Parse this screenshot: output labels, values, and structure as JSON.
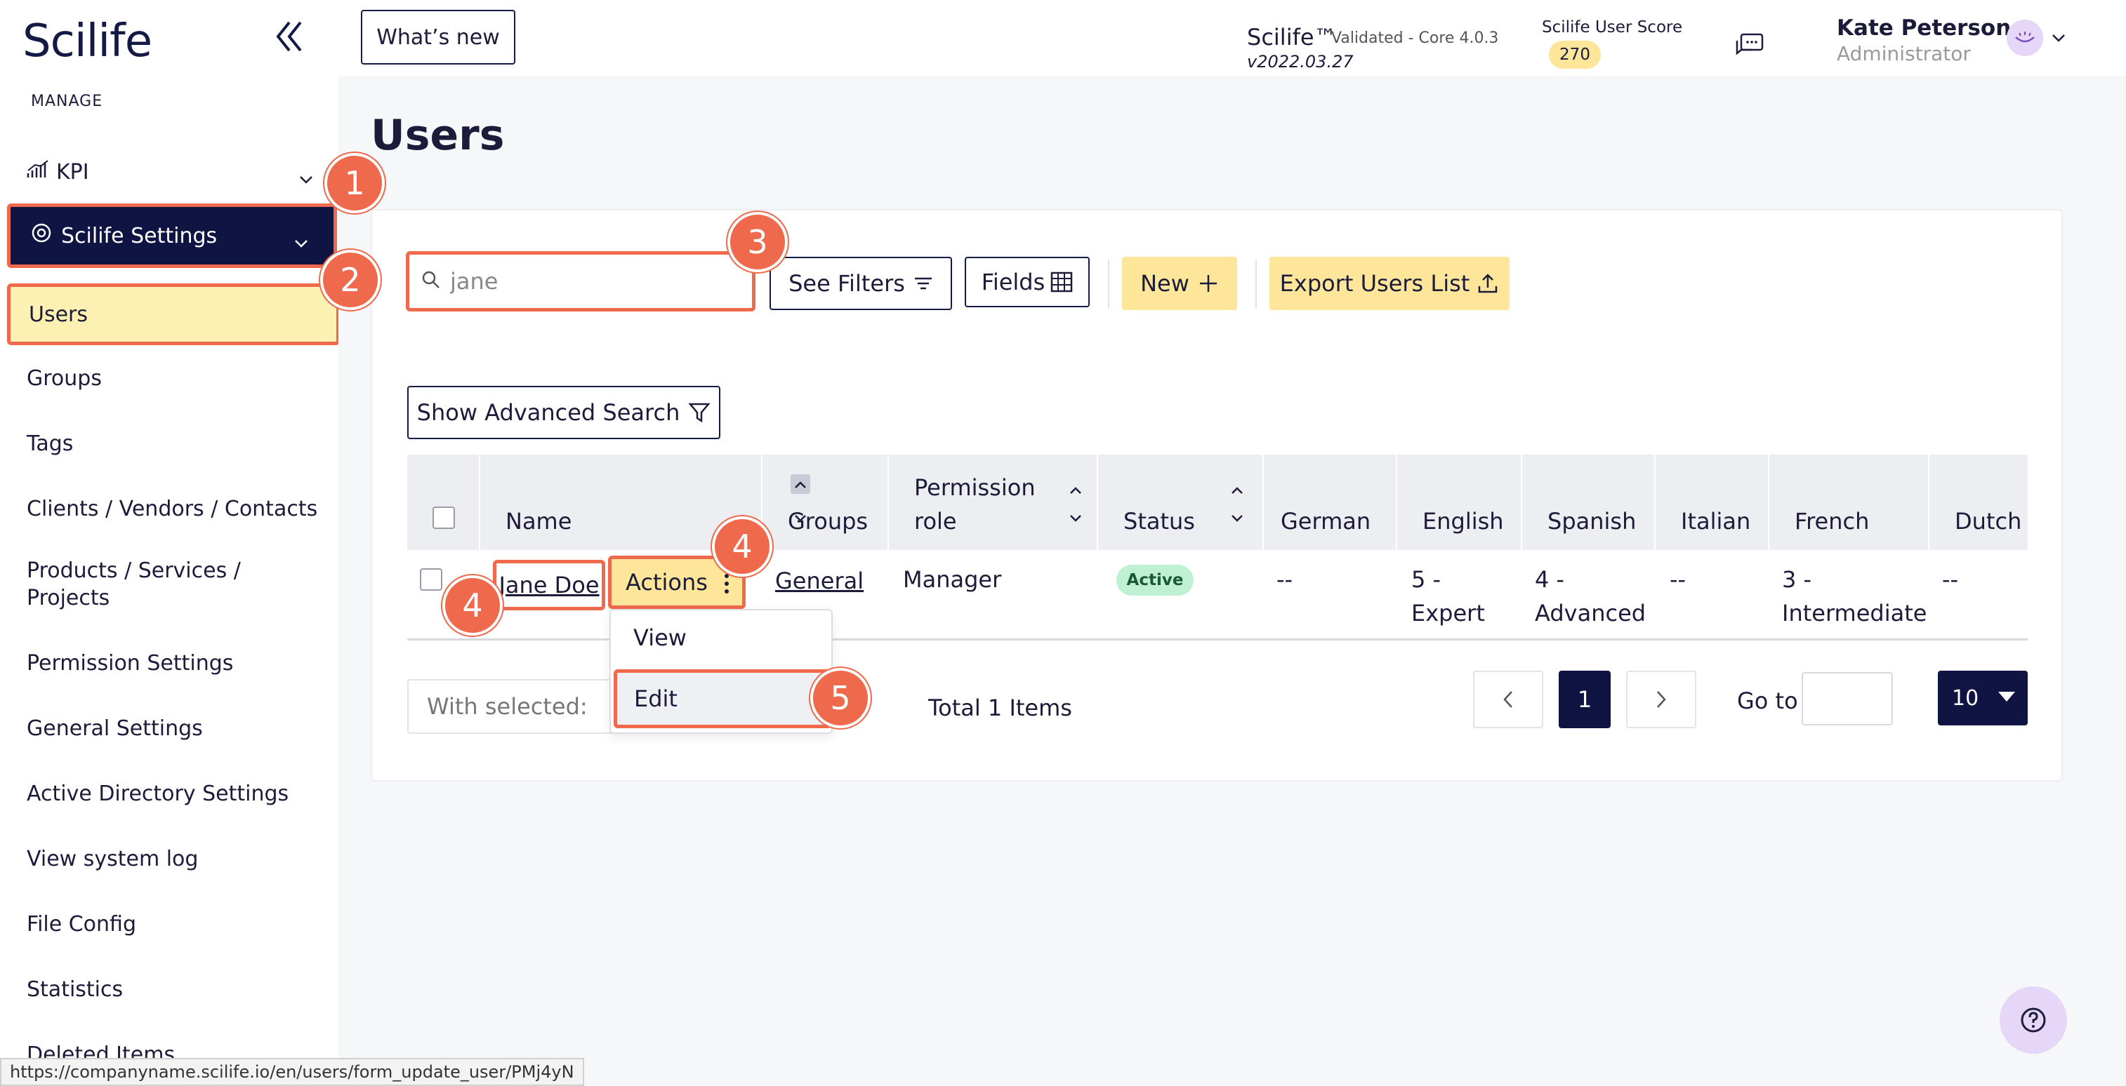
{
  "app": {
    "logo": "Scilife",
    "whats_new": "What’s new",
    "product_name": "Scilife™",
    "product_version": "Validated - Core 4.0.3",
    "build": "v2022.03.27",
    "score_label": "Scilife User Score",
    "score_value": "270"
  },
  "user": {
    "name": "Kate Peterson",
    "role": "Administrator"
  },
  "sidebar": {
    "section_label": "MANAGE",
    "kpi": "KPI",
    "scilife_settings": "Scilife Settings",
    "items": [
      {
        "label": "Users"
      },
      {
        "label": "Groups"
      },
      {
        "label": "Tags"
      },
      {
        "label": "Clients / Vendors / Contacts"
      },
      {
        "label": "Products / Services /"
      },
      {
        "label": "Projects"
      },
      {
        "label": "Permission Settings"
      },
      {
        "label": "General Settings"
      },
      {
        "label": "Active Directory Settings"
      },
      {
        "label": "View system log"
      },
      {
        "label": "File Config"
      },
      {
        "label": "Statistics"
      },
      {
        "label": "Deleted Items"
      }
    ]
  },
  "page": {
    "title": "Users"
  },
  "toolbar": {
    "search_value": "jane",
    "see_filters": "See Filters",
    "fields": "Fields",
    "new": "New",
    "export": "Export Users List",
    "advanced_search": "Show Advanced Search"
  },
  "table": {
    "headers": [
      "Name",
      "Groups",
      "Permission role",
      "Status",
      "German",
      "English",
      "Spanish",
      "Italian",
      "French",
      "Dutch"
    ],
    "header_role_line1": "Permission",
    "header_role_line2": "role",
    "row": {
      "name": "Jane Doe",
      "actions": "Actions",
      "group": "General",
      "role": "Manager",
      "status": "Active",
      "german": "--",
      "english_1": "5 -",
      "english_2": "Expert",
      "spanish_1": "4 -",
      "spanish_2": "Advanced",
      "italian": "--",
      "french_1": "3 -",
      "french_2": "Intermediate",
      "dutch": "--"
    }
  },
  "menu": {
    "view": "View",
    "edit": "Edit"
  },
  "footer": {
    "with_selected": "With selected:",
    "total": "Total 1 Items",
    "page": "1",
    "goto": "Go to",
    "page_size": "10"
  },
  "status_url": "https://companyname.scilife.io/en/users/form_update_user/PMj4yN",
  "markers": [
    "1",
    "2",
    "3",
    "4",
    "4",
    "5"
  ],
  "colors": {
    "navy": "#0f1442",
    "highlight": "#ef6a4c",
    "yellow": "#fde59a",
    "active_badge": "#bff0d2"
  }
}
